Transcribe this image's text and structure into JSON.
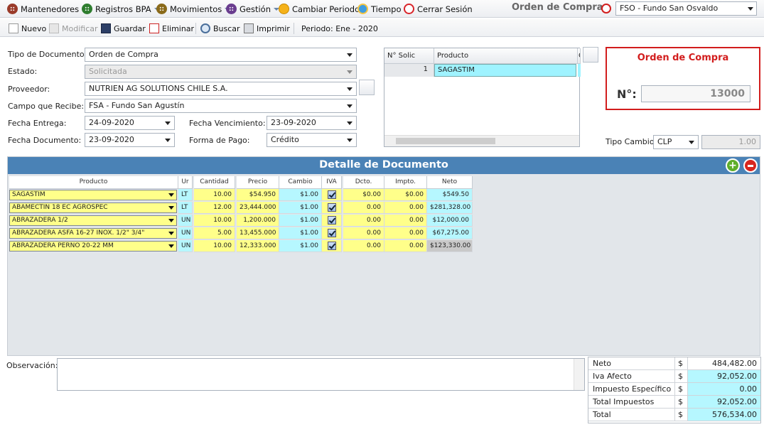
{
  "menu": {
    "items": [
      {
        "label": "Mantenedores",
        "icon": "mantenedores-icon",
        "color": "#9a3b2a"
      },
      {
        "label": "Registros BPA",
        "icon": "registros-icon",
        "color": "#2f7d2f"
      },
      {
        "label": "Movimientos",
        "icon": "movimientos-icon",
        "color": "#8a6a1a"
      },
      {
        "label": "Gestión",
        "icon": "gestion-icon",
        "color": "#6a3d8f"
      }
    ],
    "cambiar_periodo": "Cambiar Periodo",
    "tiempo": "Tiempo",
    "cerrar_sesion": "Cerrar Sesión"
  },
  "header": {
    "title": "Orden de Compra",
    "fundo": "FSO - Fundo San Osvaldo"
  },
  "toolbar": {
    "nuevo": "Nuevo",
    "modificar": "Modificar",
    "guardar": "Guardar",
    "eliminar": "Eliminar",
    "buscar": "Buscar",
    "imprimir": "Imprimir",
    "periodo": "Periodo: Ene - 2020"
  },
  "form": {
    "tipo_doc_label": "Tipo de Documento:",
    "tipo_doc": "Orden de Compra",
    "estado_label": "Estado:",
    "estado": "Solicitada",
    "proveedor_label": "Proveedor:",
    "proveedor": "NUTRIEN AG SOLUTIONS CHILE S.A.",
    "campo_label": "Campo que Recibe:",
    "campo": "FSA - Fundo San Agustín",
    "fecha_entrega_label": "Fecha Entrega:",
    "fecha_entrega": "24-09-2020",
    "fecha_venc_label": "Fecha Vencimiento:",
    "fecha_venc": "23-09-2020",
    "fecha_doc_label": "Fecha Documento:",
    "fecha_doc": "23-09-2020",
    "forma_pago_label": "Forma de Pago:",
    "forma_pago": "Crédito",
    "tipo_cambio_label": "Tipo Cambio:",
    "tipo_cambio": "CLP",
    "tipo_cambio_valor": "1.00"
  },
  "solic_grid": {
    "headers": [
      "N° Solic",
      "Producto",
      "C"
    ],
    "rows": [
      {
        "n": "1",
        "producto": "SAGASTIM"
      }
    ]
  },
  "order_box": {
    "title": "Orden de Compra",
    "num_label": "N°:",
    "numero": "13000"
  },
  "detalle": {
    "title": "Detalle de Documento",
    "headers": [
      "Producto",
      "Ur",
      "Cantidad",
      "Precio",
      "Cambio",
      "IVA",
      "Dcto.",
      "Impto.",
      "Neto"
    ],
    "rows": [
      {
        "producto": "SAGASTIM",
        "um": "LT",
        "cantidad": "10.00",
        "precio": "$54.950",
        "cambio": "$1.00",
        "iva": true,
        "dcto": "$0.00",
        "impto": "$0.00",
        "neto": "$549.50"
      },
      {
        "producto": "ABAMECTIN 18 EC AGROSPEC",
        "um": "LT",
        "cantidad": "12.00",
        "precio": "23,444.000",
        "cambio": "$1.00",
        "iva": true,
        "dcto": "0.00",
        "impto": "0.00",
        "neto": "$281,328.00"
      },
      {
        "producto": "ABRAZADERA 1/2",
        "um": "UN",
        "cantidad": "10.00",
        "precio": "1,200.000",
        "cambio": "$1.00",
        "iva": true,
        "dcto": "0.00",
        "impto": "0.00",
        "neto": "$12,000.00"
      },
      {
        "producto": "ABRAZADERA ASFA 16-27 INOX. 1/2\" 3/4\"",
        "um": "UN",
        "cantidad": "5.00",
        "precio": "13,455.000",
        "cambio": "$1.00",
        "iva": true,
        "dcto": "0.00",
        "impto": "0.00",
        "neto": "$67,275.00"
      },
      {
        "producto": "ABRAZADERA PERNO 20-22 MM",
        "um": "UN",
        "cantidad": "10.00",
        "precio": "12,333.000",
        "cambio": "$1.00",
        "iva": true,
        "dcto": "0.00",
        "impto": "0.00",
        "neto": "$123,330.00"
      }
    ]
  },
  "observacion": {
    "label": "Observación:",
    "value": ""
  },
  "totales": [
    {
      "label": "Neto",
      "currency": "$",
      "value": "484,482.00",
      "hl": false
    },
    {
      "label": "Iva Afecto",
      "currency": "$",
      "value": "92,052.00",
      "hl": true
    },
    {
      "label": "Impuesto Específico",
      "currency": "$",
      "value": "0.00",
      "hl": true
    },
    {
      "label": "Total Impuestos",
      "currency": "$",
      "value": "92,052.00",
      "hl": true
    },
    {
      "label": "Total",
      "currency": "$",
      "value": "576,534.00",
      "hl": true
    }
  ]
}
